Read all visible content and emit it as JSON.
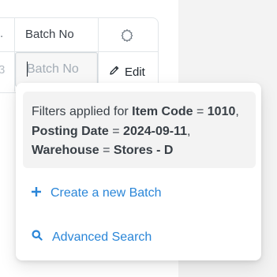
{
  "table": {
    "prev_header_truncated": ".",
    "column_header": "Batch No",
    "prev_value_truncated": "3",
    "batch_input_placeholder": "Batch No",
    "batch_input_value": "",
    "edit_label": "Edit"
  },
  "dropdown": {
    "filters_prefix": "Filters applied for",
    "filters": [
      {
        "field": "Item Code",
        "op": "=",
        "value": "1010"
      },
      {
        "field": "Posting Date",
        "op": "=",
        "value": "2024-09-11"
      },
      {
        "field": "Warehouse",
        "op": "=",
        "value": "Stores - D"
      }
    ],
    "separator": ",",
    "create_label": "Create a new Batch",
    "search_label": "Advanced Search"
  },
  "colors": {
    "link": "#2a86d8",
    "filter_box_bg": "#f3f3f3",
    "border": "#e2e6e9"
  },
  "icons": {
    "settings": "gear-icon",
    "edit": "pencil-icon",
    "create": "plus-icon",
    "search": "search-icon"
  }
}
